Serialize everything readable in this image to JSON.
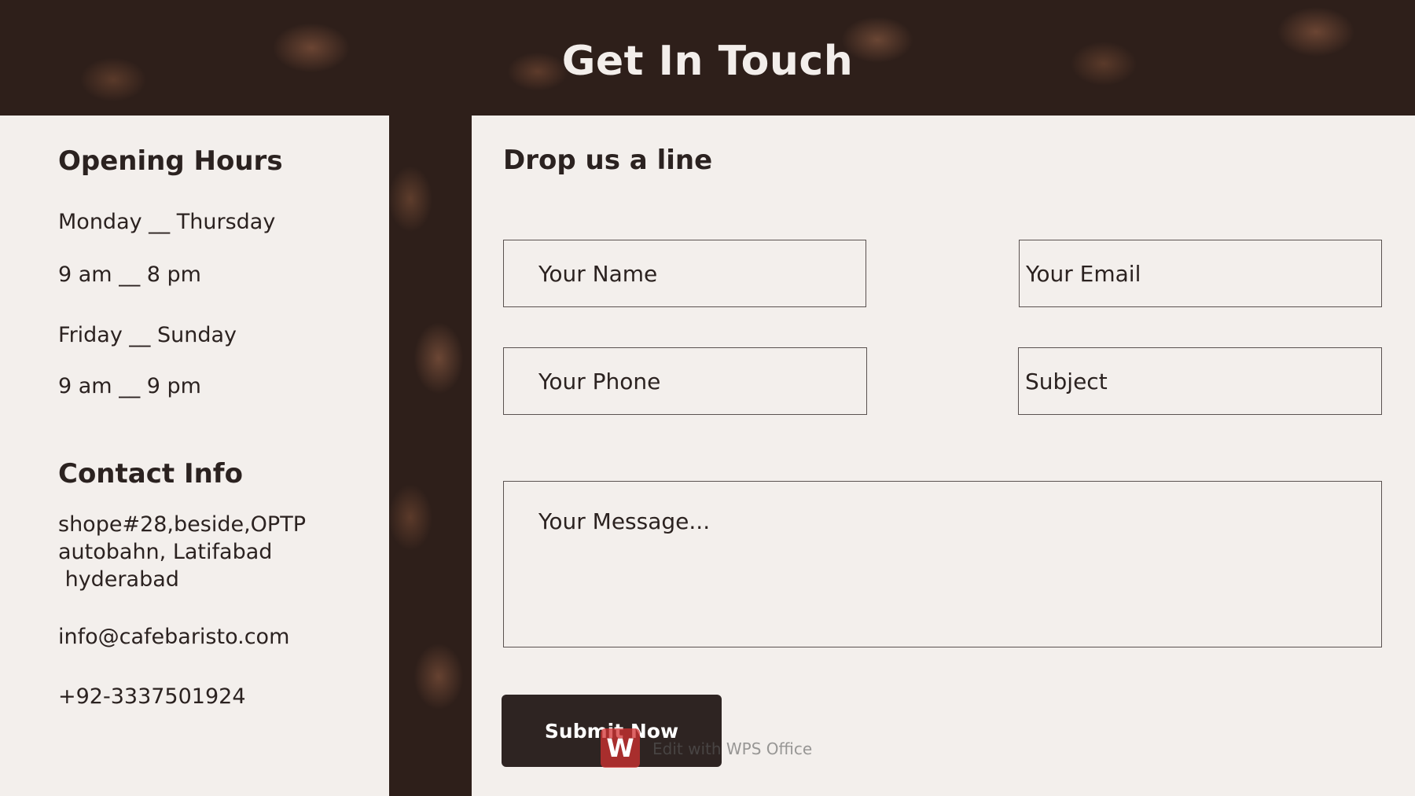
{
  "hero": {
    "title": "Get In Touch"
  },
  "opening_hours": {
    "heading": "Opening Hours",
    "lines": [
      "Monday __ Thursday",
      "9 am __ 8 pm",
      "Friday __ Sunday",
      "9 am __ 9 pm"
    ]
  },
  "contact_info": {
    "heading": "Contact Info",
    "address_lines": [
      "shope#28,beside,OPTP",
      "autobahn, Latifabad",
      " hyderabad"
    ],
    "email": "info@cafebaristo.com",
    "phone": "+92-3337501924"
  },
  "form": {
    "heading": "Drop us a line",
    "name_placeholder": "Your Name",
    "email_placeholder": "Your Email",
    "phone_placeholder": "Your Phone",
    "subject_placeholder": "Subject",
    "message_placeholder": "Your Message...",
    "submit_label": "Submit Now"
  },
  "watermark": {
    "icon_letter": "W",
    "text": "Edit with WPS Office"
  },
  "colors": {
    "panel_background": "#f3efec",
    "text_dark": "#2b2220",
    "button_background": "#2e2422",
    "hero_title": "#f3eeeb"
  }
}
